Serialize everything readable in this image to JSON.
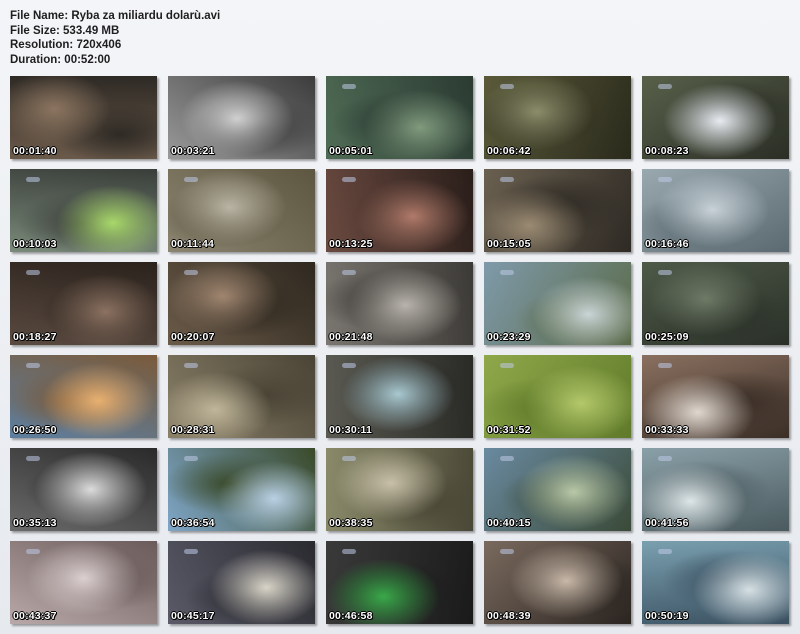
{
  "file_info": {
    "name_line": "File Name: Ryba za miliardu dolarù.avi",
    "size_line": "File Size: 533.49 MB",
    "resolution_line": "Resolution: 720x406",
    "duration_line": "Duration: 00:52:00"
  },
  "thumbnails": [
    {
      "time": "00:01:40",
      "scene": "man-closeup",
      "colors": [
        "#6b5a4a",
        "#2e2a25",
        "#8c7560"
      ]
    },
    {
      "time": "00:03:21",
      "scene": "bw-fishermen-photo",
      "colors": [
        "#9a9a9a",
        "#3c3c3c",
        "#d0d0d0"
      ]
    },
    {
      "time": "00:05:01",
      "scene": "underwater-sturgeon",
      "colors": [
        "#4f6b55",
        "#2b3b32",
        "#7f9a7d"
      ]
    },
    {
      "time": "00:06:42",
      "scene": "sturgeon-in-hands",
      "colors": [
        "#5a5a3a",
        "#2a2a1c",
        "#8b8d6a"
      ]
    },
    {
      "time": "00:08:23",
      "scene": "hand-drawing",
      "colors": [
        "#58604a",
        "#2a2e25",
        "#e8ecf2"
      ]
    },
    {
      "time": "00:10:03",
      "scene": "green-bowl",
      "colors": [
        "#7a8a7a",
        "#3a3e3a",
        "#a8d86a"
      ]
    },
    {
      "time": "00:11:44",
      "scene": "boat-on-shore",
      "colors": [
        "#8b8470",
        "#5d5640",
        "#b9b5a4"
      ]
    },
    {
      "time": "00:13:25",
      "scene": "fish-on-table",
      "colors": [
        "#6a4a40",
        "#2a1e1a",
        "#b07a6a"
      ]
    },
    {
      "time": "00:15:05",
      "scene": "fishing-net",
      "colors": [
        "#6a6050",
        "#2e2a24",
        "#9a8a72"
      ]
    },
    {
      "time": "00:16:46",
      "scene": "river-boat",
      "colors": [
        "#9aa8b0",
        "#5a6a70",
        "#c8d2d8"
      ]
    },
    {
      "time": "00:18:27",
      "scene": "man-holding-fish",
      "colors": [
        "#5a4a40",
        "#2a221c",
        "#8c7262"
      ]
    },
    {
      "time": "00:20:07",
      "scene": "man-talking-hands",
      "colors": [
        "#6a5a48",
        "#2e281f",
        "#a08670"
      ]
    },
    {
      "time": "00:21:48",
      "scene": "man-in-hall",
      "colors": [
        "#7a7670",
        "#3c3a36",
        "#b8b4ac"
      ]
    },
    {
      "time": "00:23:29",
      "scene": "sea-beach-reeds",
      "colors": [
        "#7f9aaa",
        "#5a6a48",
        "#c9d4d6"
      ]
    },
    {
      "time": "00:25:09",
      "scene": "dark-underwater",
      "colors": [
        "#4e5a48",
        "#2a3028",
        "#6e7a66"
      ]
    },
    {
      "time": "00:26:50",
      "scene": "cliffs-sunset",
      "colors": [
        "#5d7fa0",
        "#7a5a3a",
        "#e8b070"
      ]
    },
    {
      "time": "00:28:31",
      "scene": "men-sitting-outdoor",
      "colors": [
        "#8a8068",
        "#4a4436",
        "#c0b69a"
      ]
    },
    {
      "time": "00:30:11",
      "scene": "hands-water-tray",
      "colors": [
        "#5a5a52",
        "#2a2a26",
        "#a8c8d0"
      ]
    },
    {
      "time": "00:31:52",
      "scene": "green-blur",
      "colors": [
        "#8fa84a",
        "#5f7a2a",
        "#b4c86a"
      ]
    },
    {
      "time": "00:33:33",
      "scene": "man-glasses-lab",
      "colors": [
        "#8a7060",
        "#3a2e26",
        "#e0d8d0"
      ]
    },
    {
      "time": "00:35:13",
      "scene": "man-with-device",
      "colors": [
        "#6a6a6a",
        "#2a2a2a",
        "#dcdcdc"
      ]
    },
    {
      "time": "00:36:54",
      "scene": "birds-in-tree",
      "colors": [
        "#7fa6c8",
        "#3a4a2a",
        "#b8d0e4"
      ]
    },
    {
      "time": "00:38:35",
      "scene": "people-in-street",
      "colors": [
        "#8a8a6a",
        "#4a4836",
        "#c8c0a8"
      ]
    },
    {
      "time": "00:40:15",
      "scene": "man-in-garden",
      "colors": [
        "#6a8aa0",
        "#3a4a38",
        "#b8c8a8"
      ]
    },
    {
      "time": "00:41:56",
      "scene": "man-surgical-mask",
      "colors": [
        "#8aa0a8",
        "#4a5a5e",
        "#dde6e8"
      ]
    },
    {
      "time": "00:43:37",
      "scene": "sturgeon-head-closeup",
      "colors": [
        "#b8a8a8",
        "#6a5a5a",
        "#dcd0d0"
      ]
    },
    {
      "time": "00:45:17",
      "scene": "boots-and-legs",
      "colors": [
        "#5a5a68",
        "#2a2a30",
        "#d8d4c8"
      ]
    },
    {
      "time": "00:46:58",
      "scene": "lab-monitor",
      "colors": [
        "#3a3a3a",
        "#1a1a1a",
        "#3aa84a"
      ]
    },
    {
      "time": "00:48:39",
      "scene": "man-glasses-portrait",
      "colors": [
        "#7a6a5e",
        "#2a2420",
        "#c8b8a8"
      ]
    },
    {
      "time": "00:50:19",
      "scene": "men-on-boat",
      "colors": [
        "#7aa0b0",
        "#3a5060",
        "#d6e0e4"
      ]
    }
  ]
}
